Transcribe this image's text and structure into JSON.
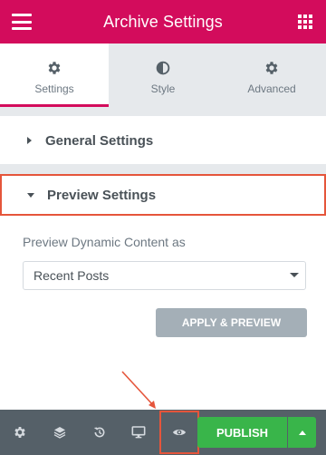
{
  "header": {
    "title": "Archive Settings",
    "menu_icon": "hamburger-menu-icon",
    "apps_icon": "grid-apps-icon"
  },
  "tabs": [
    {
      "label": "Settings",
      "icon": "gear-icon",
      "active": true
    },
    {
      "label": "Style",
      "icon": "half-circle-icon",
      "active": false
    },
    {
      "label": "Advanced",
      "icon": "gear-icon",
      "active": false
    }
  ],
  "sections": {
    "general": {
      "label": "General Settings",
      "expanded": false
    },
    "preview": {
      "label": "Preview Settings",
      "expanded": true
    }
  },
  "preview": {
    "control_label": "Preview Dynamic Content as",
    "select_value": "Recent Posts",
    "apply_label": "APPLY & PREVIEW"
  },
  "footer": {
    "icons": [
      "settings-gear-icon",
      "layers-icon",
      "history-icon",
      "responsive-desktop-icon",
      "preview-eye-icon"
    ],
    "publish_label": "PUBLISH"
  },
  "colors": {
    "brand": "#d30c5c",
    "publish": "#39b54a",
    "highlight": "#e5553b",
    "footer_bg": "#556068"
  }
}
